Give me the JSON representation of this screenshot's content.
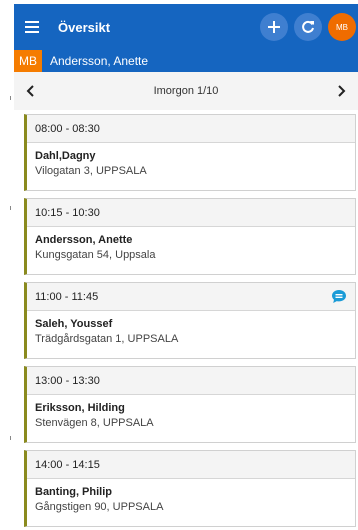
{
  "header": {
    "title": "Översikt",
    "avatar_initials": "MB"
  },
  "user": {
    "initials": "MB",
    "name": "Andersson, Anette"
  },
  "datebar": {
    "label": "Imorgon 1/10"
  },
  "appointments": [
    {
      "time": "08:00 - 08:30",
      "name": "Dahl,Dagny",
      "address": "Vilogatan 3, UPPSALA",
      "has_message": false
    },
    {
      "time": "10:15 - 10:30",
      "name": "Andersson, Anette",
      "address": "Kungsgatan 54, Uppsala",
      "has_message": false
    },
    {
      "time": "11:00 - 11:45",
      "name": "Saleh, Youssef",
      "address": "Trädgårdsgatan 1, UPPSALA",
      "has_message": true
    },
    {
      "time": "13:00 - 13:30",
      "name": "Eriksson, Hilding",
      "address": "Stenvägen 8, UPPSALA",
      "has_message": false
    },
    {
      "time": "14:00 - 14:15",
      "name": "Banting, Philip",
      "address": "Gångstigen 90, UPPSALA",
      "has_message": false
    }
  ],
  "colors": {
    "header_blue": "#1565c0",
    "badge_orange": "#f57c00",
    "card_accent": "#8a8a1e",
    "chat_icon": "#1a9bd7"
  },
  "icons": {
    "menu": "hamburger-menu-icon",
    "add": "plus-icon",
    "refresh": "refresh-icon",
    "prev": "chevron-left-icon",
    "next": "chevron-right-icon",
    "message": "chat-bubble-icon"
  }
}
